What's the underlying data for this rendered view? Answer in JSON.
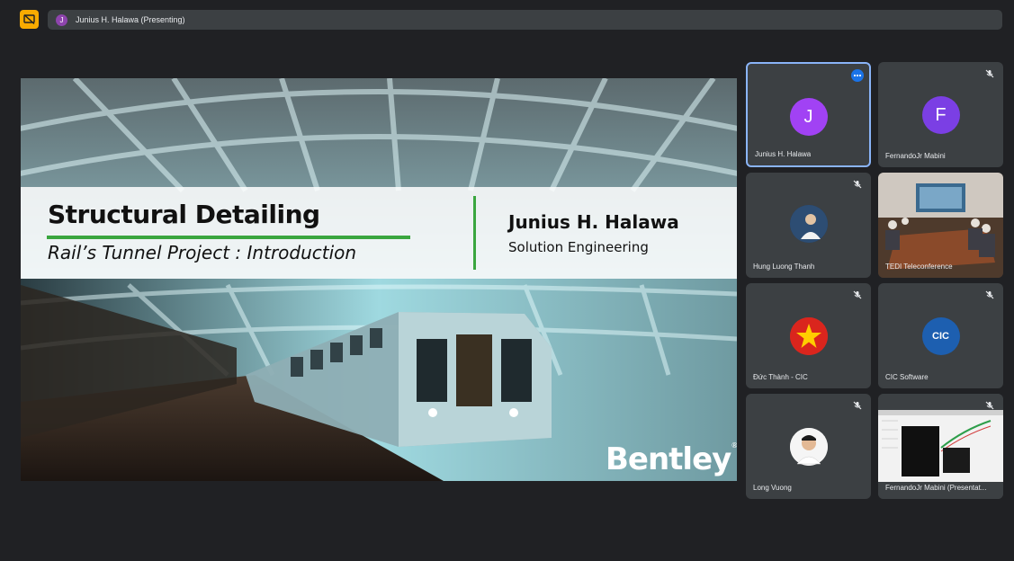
{
  "topbar": {
    "avatar_letter": "J",
    "presenting_label": "Junius H. Halawa (Presenting)"
  },
  "slide": {
    "title": "Structural Detailing",
    "subtitle": "Rail’s Tunnel Project : Introduction",
    "presenter_name": "Junius H. Halawa",
    "presenter_role": "Solution Engineering",
    "logo_text": "Bentley",
    "logo_mark": "®"
  },
  "participants": [
    {
      "name": "Junius H. Halawa",
      "avatar_letter": "J",
      "avatar_color": "#a142f4",
      "active": true
    },
    {
      "name": "FernandoJr Mabini",
      "avatar_letter": "F",
      "avatar_color": "#7b3fe4"
    },
    {
      "name": "Hung Luong Thanh"
    },
    {
      "name": "TEDI Teleconference"
    },
    {
      "name": "Đức Thành - CIC"
    },
    {
      "name": "CIC Software",
      "avatar_letter": "CIC"
    },
    {
      "name": "Long Vuong"
    },
    {
      "name": "FernandoJr Mabini (Presentat..."
    }
  ],
  "colors": {
    "background": "#202124",
    "tile": "#3c4043",
    "present_button": "#f9ab00",
    "active_border": "#8ab4f8",
    "accent_green": "#3aa63f"
  }
}
